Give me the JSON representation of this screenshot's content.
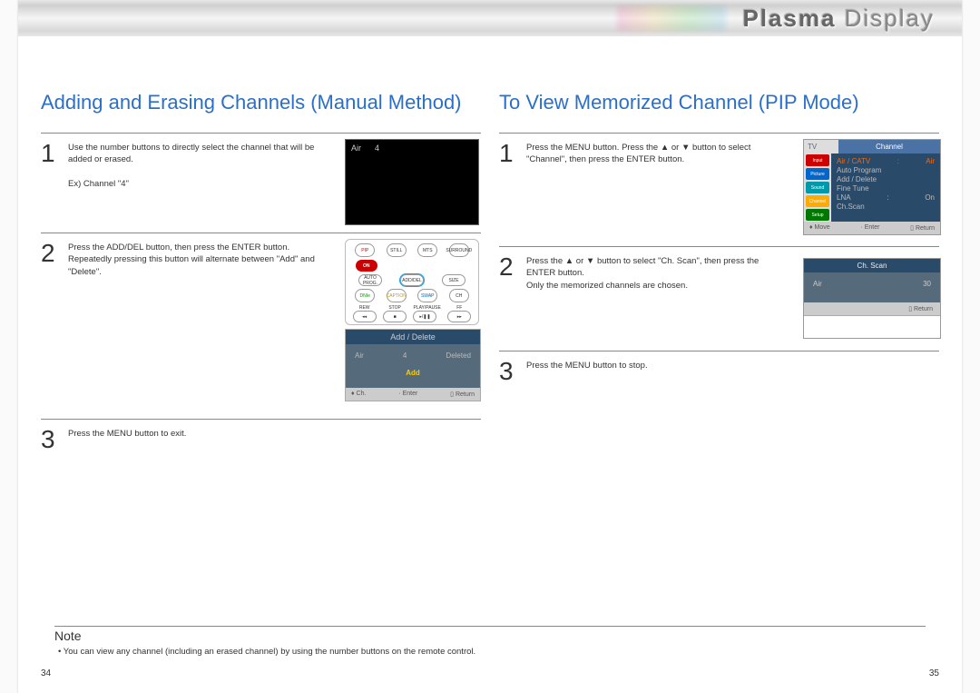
{
  "header": {
    "product": "Plasma",
    "product2": "Display"
  },
  "left": {
    "title": "Adding and Erasing Channels (Manual Method)",
    "step1": {
      "text": "Use the number buttons to directly select the channel that will be added or erased.",
      "example": "Ex) Channel \"4\"",
      "screen": {
        "source": "Air",
        "number": "4"
      }
    },
    "step2": {
      "text": "Press the ADD/DEL button, then press the ENTER button. Repeatedly pressing this button will alternate between \"Add\" and \"Delete\".",
      "remote": {
        "row1": [
          "PIP",
          "STILL",
          "MTS",
          "SURROUND"
        ],
        "on": "ON",
        "row2": [
          "AUTO PROG.",
          "ADD/DEL",
          "SIZE"
        ],
        "row3": [
          "DNIe",
          "CAPTION",
          "SWAP",
          "CH"
        ],
        "row4": [
          "REW",
          "STOP",
          "PLAY/PAUSE",
          "FF"
        ],
        "row4sym": [
          "◂◂",
          "■",
          "▸/❚❚",
          "▸▸"
        ]
      },
      "panel": {
        "title": "Add / Delete",
        "source": "Air",
        "num": "4",
        "status": "Deleted",
        "action": "Add",
        "foot1": "Ch.",
        "foot2": "Enter",
        "foot3": "Return"
      }
    },
    "step3": {
      "text": "Press the MENU button to exit."
    }
  },
  "right": {
    "title": "To View Memorized Channel (PIP Mode)",
    "step1": {
      "text": "Press the MENU button. Press the ▲ or ▼ button to select \"Channel\", then press the ENTER button.",
      "menu": {
        "tv": "TV",
        "title": "Channel",
        "tabs": [
          "Input",
          "Picture",
          "Sound",
          "Channel",
          "Setup"
        ],
        "rows": [
          {
            "label": "Air / CATV",
            "val": "Air",
            "sep": ":",
            "sel": true
          },
          {
            "label": "Auto Program",
            "val": "",
            "sep": ""
          },
          {
            "label": "Add / Delete",
            "val": "",
            "sep": ""
          },
          {
            "label": "Fine Tune",
            "val": "",
            "sep": ""
          },
          {
            "label": "LNA",
            "val": "On",
            "sep": ":"
          },
          {
            "label": "Ch.Scan",
            "val": "",
            "sep": ""
          }
        ],
        "foot1": "Move",
        "foot2": "Enter",
        "foot3": "Return"
      }
    },
    "step2": {
      "text": "Press the ▲ or ▼ button to select \"Ch. Scan\", then press the ENTER button.",
      "text2": "Only the memorized channels are chosen.",
      "panel": {
        "title": "Ch. Scan",
        "source": "Air",
        "num": "30",
        "foot": "Return"
      }
    },
    "step3": {
      "text": "Press the MENU button to stop."
    }
  },
  "note": {
    "title": "Note",
    "text": "• You can view any channel (including an erased channel) by using the number buttons on the remote control."
  },
  "pageLeft": "34",
  "pageRight": "35"
}
